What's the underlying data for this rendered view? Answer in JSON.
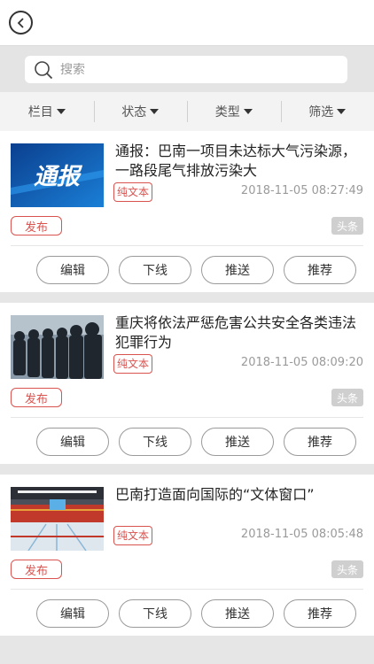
{
  "search": {
    "placeholder": "搜索"
  },
  "filters": [
    {
      "label": "栏目"
    },
    {
      "label": "状态"
    },
    {
      "label": "类型"
    },
    {
      "label": "筛选"
    }
  ],
  "thumb_texts": {
    "tongbao": "通报"
  },
  "articles": [
    {
      "title": "通报：巴南一项目未达标大气污染源，一路段尾气排放污染大",
      "type_badge": "纯文本",
      "time": "2018-11-05 08:27:49",
      "status_tag": "发布",
      "headline_tag": "头条",
      "actions": {
        "edit": "编辑",
        "offline": "下线",
        "push": "推送",
        "recommend": "推荐"
      }
    },
    {
      "title": "重庆将依法严惩危害公共安全各类违法犯罪行为",
      "type_badge": "纯文本",
      "time": "2018-11-05 08:09:20",
      "status_tag": "发布",
      "headline_tag": "头条",
      "actions": {
        "edit": "编辑",
        "offline": "下线",
        "push": "推送",
        "recommend": "推荐"
      }
    },
    {
      "title": "巴南打造面向国际的“文体窗口”",
      "type_badge": "纯文本",
      "time": "2018-11-05 08:05:48",
      "status_tag": "发布",
      "headline_tag": "头条",
      "actions": {
        "edit": "编辑",
        "offline": "下线",
        "push": "推送",
        "recommend": "推荐"
      }
    }
  ],
  "colors": {
    "accent_red": "#d9534f",
    "tag_gray": "#cfcfcf",
    "bg_gray": "#e9e9e9"
  },
  "icons": {
    "back": "back-arrow-icon",
    "search": "search-icon",
    "dropdown": "caret-down-icon"
  }
}
